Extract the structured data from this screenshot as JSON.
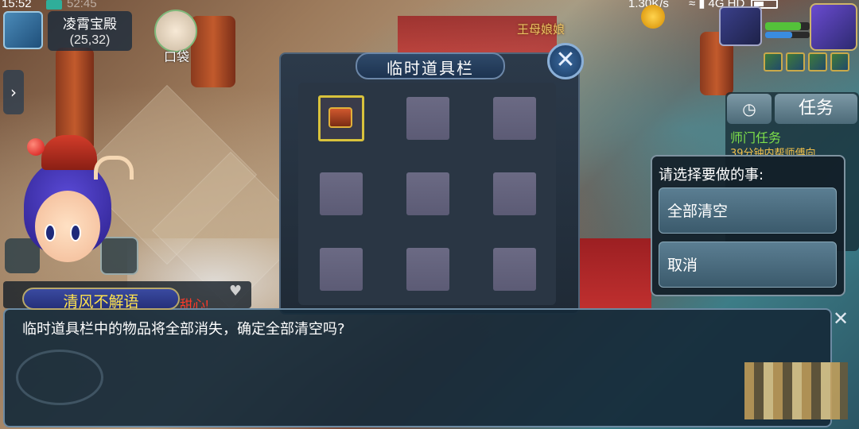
{
  "statusbar": {
    "time": "15:52",
    "ghost_time": "52:45",
    "speed": "1.30K/s",
    "network": "4G HD"
  },
  "location": {
    "name": "凌霄宝殿",
    "coords": "(25,32)"
  },
  "bag": {
    "label": "口袋"
  },
  "npc": {
    "name": "王母娘娘"
  },
  "quest": {
    "tab_label": "任务",
    "title": "师门任务",
    "desc": "39分钟内帮师傅向"
  },
  "item_panel": {
    "title": "临时道具栏",
    "slots": [
      {
        "filled": true,
        "icon": "treasure-chest-icon"
      },
      {
        "filled": false
      },
      {
        "filled": false
      },
      {
        "filled": false
      },
      {
        "filled": false
      },
      {
        "filled": false
      },
      {
        "filled": false
      },
      {
        "filled": false
      },
      {
        "filled": false
      }
    ]
  },
  "choice": {
    "title": "请选择要做的事:",
    "options": [
      "全部清空",
      "取消"
    ]
  },
  "dialog": {
    "speaker": "清风不解语",
    "text": "临时道具栏中的物品将全部消失，确定全部清空吗?"
  },
  "chat_hint": "甜心!"
}
